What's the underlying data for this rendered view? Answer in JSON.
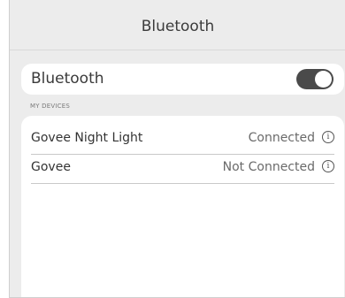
{
  "nav": {
    "title": "Bluetooth"
  },
  "bluetooth": {
    "label": "Bluetooth",
    "toggle_on": true
  },
  "devices": {
    "section_header": "MY DEVICES",
    "items": [
      {
        "name": "Govee Night Light",
        "status": "Connected",
        "info_icon": "info-icon"
      },
      {
        "name": "Govee",
        "status": "Not Connected",
        "info_icon": "info-icon"
      }
    ]
  }
}
